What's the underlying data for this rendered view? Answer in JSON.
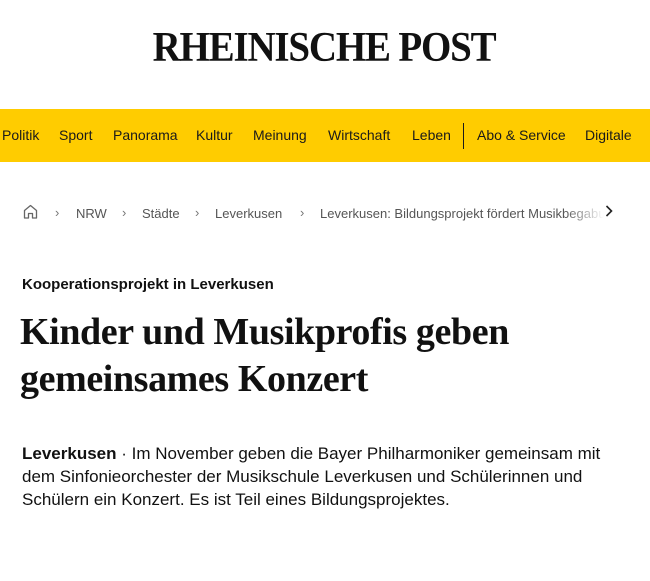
{
  "masthead": {
    "logo_text": "RHEINISCHE POST"
  },
  "nav": {
    "items": [
      "Politik",
      "Sport",
      "Panorama",
      "Kultur",
      "Meinung",
      "Wirtschaft",
      "Leben"
    ],
    "items_secondary": [
      "Abo & Service",
      "Digitale"
    ],
    "background_color": "#ffcc00"
  },
  "breadcrumb": {
    "home_icon": "home-icon",
    "items": [
      "NRW",
      "Städte",
      "Leverkusen"
    ],
    "current": "Leverkusen: Bildungsprojekt fördert Musikbegabung",
    "separator": "›"
  },
  "article": {
    "kicker": "Kooperationsprojekt in Leverkusen",
    "headline": "Kinder und Musikprofis geben gemeinsames Konzert",
    "location": "Leverkusen",
    "dateline_separator": " · ",
    "teaser": "Im November geben die Bayer Philharmoniker gemeinsam mit dem Sinfonieorchester der Musikschule Leverkusen und Schülerinnen und Schülern ein Konzert. Es ist Teil eines Bildungsprojektes."
  }
}
